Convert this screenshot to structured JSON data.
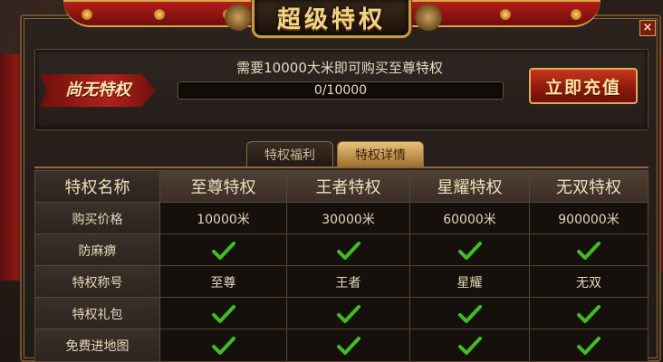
{
  "title": "超级特权",
  "close_label": "×",
  "status": {
    "tag": "尚无特权",
    "need_text": "需要10000大米即可购买至尊特权",
    "progress_text": "0/10000",
    "progress_fraction": 0,
    "recharge_label": "立即充值"
  },
  "tabs": [
    {
      "label": "特权福利",
      "active": false
    },
    {
      "label": "特权详情",
      "active": true
    }
  ],
  "table": {
    "headers": [
      "特权名称",
      "至尊特权",
      "王者特权",
      "星耀特权",
      "无双特权"
    ],
    "rows": [
      {
        "label": "购买价格",
        "values": [
          "10000米",
          "30000米",
          "60000米",
          "900000米"
        ]
      },
      {
        "label": "防麻痹",
        "values": [
          "check",
          "check",
          "check",
          "check"
        ]
      },
      {
        "label": "特权称号",
        "values": [
          "至尊",
          "王者",
          "星耀",
          "无双"
        ]
      },
      {
        "label": "特权礼包",
        "values": [
          "check",
          "check",
          "check",
          "check"
        ]
      },
      {
        "label": "免费进地图",
        "values": [
          "check",
          "check",
          "check",
          "check"
        ]
      }
    ]
  },
  "colors": {
    "accent_gold": "#d9a54a",
    "check_green": "#3fbf1f",
    "ribbon_red": "#b41e1a"
  }
}
